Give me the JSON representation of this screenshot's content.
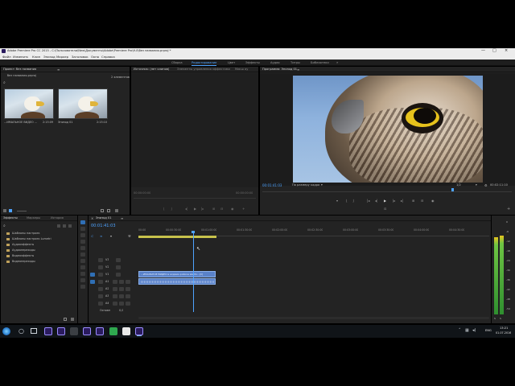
{
  "app": {
    "title": "Adobe Premiere Pro CC 2015 - C:\\Пользователи\\New\\Документы\\Adobe\\Premiere Pro\\9.0\\без названия.prproj *",
    "window_buttons": [
      "—",
      "□",
      "×"
    ]
  },
  "menu": [
    "Файл",
    "Изменить",
    "Клип",
    "Эпизод",
    "Маркер",
    "Заголовок",
    "Окно",
    "Справка"
  ],
  "workspaces": [
    {
      "label": "Сборка",
      "active": false
    },
    {
      "label": "Редактирование",
      "active": true
    },
    {
      "label": "Цвет",
      "active": false
    },
    {
      "label": "Эффекты",
      "active": false
    },
    {
      "label": "Аудио",
      "active": false
    },
    {
      "label": "Титры",
      "active": false
    },
    {
      "label": "Библиотеки",
      "active": false
    }
  ],
  "project_panel": {
    "tab": "Проект: без названия",
    "file": "без названия.prproj",
    "item_count": "2 элементов",
    "items": [
      {
        "name": "...ИМАЛЬНОЕ ВИДЕО ...",
        "duration": "2:15:09"
      },
      {
        "name": "Эпизод 01",
        "duration": "2:15:10"
      }
    ]
  },
  "source_panel": {
    "tabs": [
      "Источник: (нет клипов)",
      "Элементы управления эффектами",
      "Микш ау"
    ],
    "timecode_left": "00:00:00:00",
    "timecode_right": "00:00:00:00"
  },
  "program_panel": {
    "tab": "Программа: Эпизод 01",
    "timecode": "00:01:41:03",
    "fit": "По размеру кадра",
    "quality": "1/2",
    "duration": "00:02:11:10"
  },
  "effects_panel": {
    "tabs": [
      "Эффекты",
      "Маркеры",
      "История"
    ],
    "folders": [
      "Шаблоны настроек",
      "Шаблоны настроек Lumetri",
      "Аудиоэффекты",
      "Аудиопереходы",
      "Видеоэффекты",
      "Видеопереходы"
    ]
  },
  "timeline": {
    "tab": "Эпизод 01",
    "timecode": "00:01:41:03",
    "ruler": [
      "00:00",
      "00:00:30:00",
      "00:01:00:00",
      "00:01:30:00",
      "00:02:00:00",
      "00:02:30:00",
      "00:03:00:00",
      "00:03:30:00",
      "00:04:00:00",
      "00:04:30:00",
      "00:05:00:00"
    ],
    "video_tracks": [
      "V3",
      "V2",
      "V1"
    ],
    "audio_tracks": [
      "A1",
      "A2",
      "A3",
      "A4"
    ],
    "master_label": "Основн",
    "master_value": "0,0",
    "clip_label": "...ИМАЛЬНОЕ ВИДЕО в ахдамк-ройкхе мм бх...[V]",
    "playhead_fraction": 0.155
  },
  "meter": {
    "scale": [
      "0",
      "-6",
      "-12",
      "-18",
      "-24",
      "-30",
      "-36",
      "-42",
      "-48",
      "-54"
    ],
    "solo": [
      "S",
      "S"
    ]
  },
  "taskbar": {
    "time": "13:21",
    "date": "01.07.2016",
    "lang": "ENG"
  },
  "colors": {
    "accent": "#4ea3ff",
    "clip_video": "#5a82c9",
    "clip_bar": "#c7c24c",
    "premiere_purple": "#2a1b5e"
  }
}
